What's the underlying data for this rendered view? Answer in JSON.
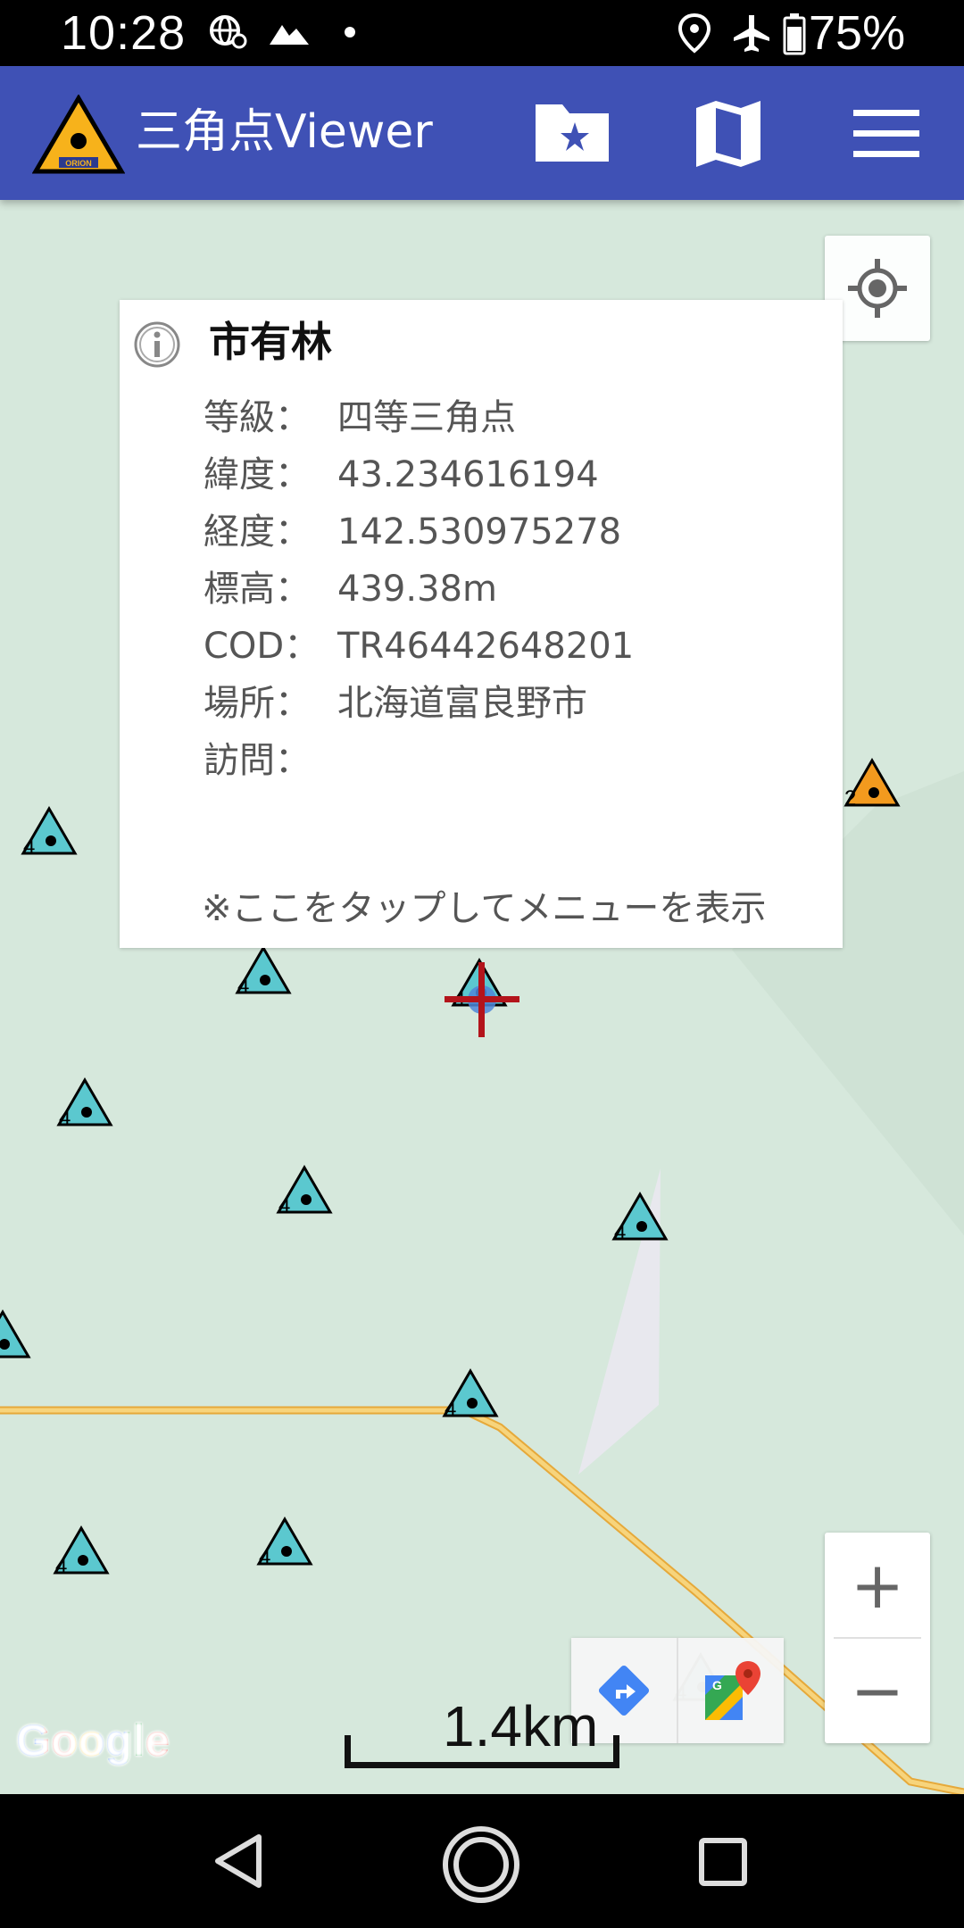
{
  "status_bar": {
    "time": "10:28",
    "battery": "75%",
    "icons": [
      "vpn-globe-icon",
      "mountain-notification-icon",
      "dot-icon",
      "location-icon",
      "airplane-mode-icon",
      "battery-icon"
    ]
  },
  "app_bar": {
    "title": "三角点Viewer",
    "logo_text": "ORION",
    "actions": [
      "favorites-folder-icon",
      "map-icon",
      "menu-icon"
    ],
    "color": "#3f51b5"
  },
  "info_window": {
    "title": "市有林",
    "rows": [
      {
        "label": "等級：",
        "value": "四等三角点"
      },
      {
        "label": "緯度：",
        "value": "43.234616194"
      },
      {
        "label": "経度：",
        "value": "142.530975278"
      },
      {
        "label": "標高：",
        "value": "439.38m"
      },
      {
        "label": "COD：",
        "value": "TR46442648201"
      },
      {
        "label": "場所：",
        "value": "北海道富良野市"
      },
      {
        "label": "訪問：",
        "value": ""
      }
    ],
    "hint": "※ここをタップしてメニューを表示"
  },
  "map": {
    "markers": [
      {
        "grade": "4"
      },
      {
        "grade": "4"
      },
      {
        "grade": "4"
      },
      {
        "grade": "4"
      },
      {
        "grade": "4"
      },
      {
        "grade": "4"
      },
      {
        "grade": "4"
      },
      {
        "grade": "4"
      },
      {
        "grade": "4"
      },
      {
        "grade": "2"
      },
      {
        "grade": "4"
      },
      {
        "grade": "4"
      }
    ],
    "marker_color_grade4": "#5bc8cf",
    "marker_color_grade2": "#f39a1e",
    "crosshair_color": "#b3141b",
    "road_color": "#f5c04a",
    "scale_label": "1.4km",
    "attribution": "Google"
  },
  "controls": {
    "zoom_in": "+",
    "zoom_out": "−",
    "icons": [
      "my-location-icon",
      "directions-icon",
      "google-maps-icon"
    ]
  },
  "nav_bar": {
    "icons": [
      "back-icon",
      "home-icon",
      "recents-icon"
    ]
  }
}
